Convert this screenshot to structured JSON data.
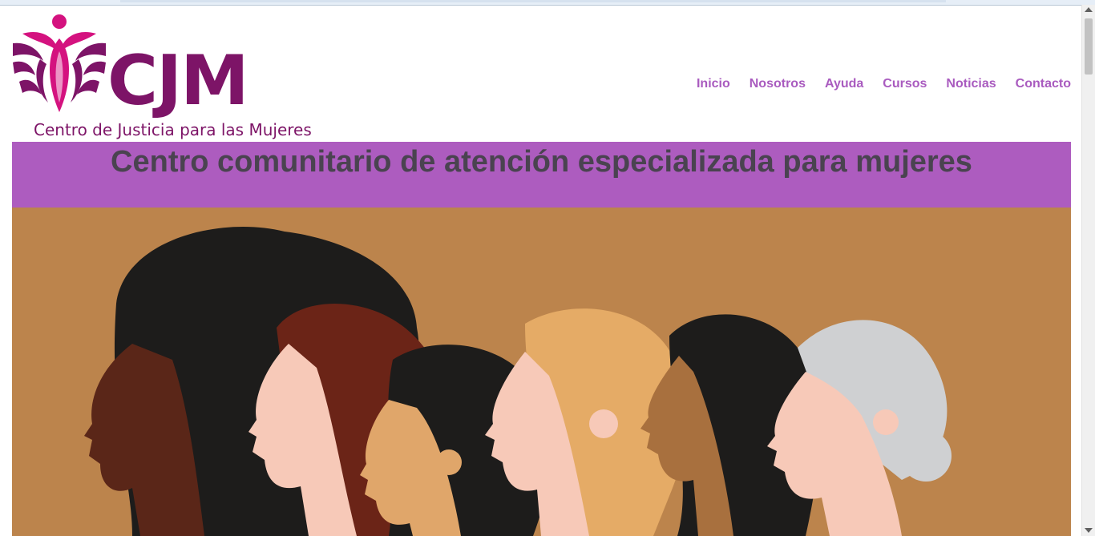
{
  "logo": {
    "letters": "CJM",
    "tagline": "Centro de Justicia para las Mujeres",
    "mark_icon": "butterfly-woman-icon"
  },
  "nav": {
    "items": [
      {
        "label": "Inicio"
      },
      {
        "label": "Nosotros"
      },
      {
        "label": "Ayuda"
      },
      {
        "label": "Cursos"
      },
      {
        "label": "Noticias"
      },
      {
        "label": "Contacto"
      }
    ]
  },
  "banner": {
    "title": "Centro comunitario de atención especializada para mujeres"
  },
  "hero": {
    "illustration": "diverse-women-profiles-illustration"
  },
  "colors": {
    "brand_purple": "#7d1467",
    "brand_magenta": "#d4127f",
    "nav_purple": "#a95bbf",
    "banner_bg": "#ad5cbf",
    "banner_text": "#4a4350",
    "hero_bg": "#bc844c"
  }
}
